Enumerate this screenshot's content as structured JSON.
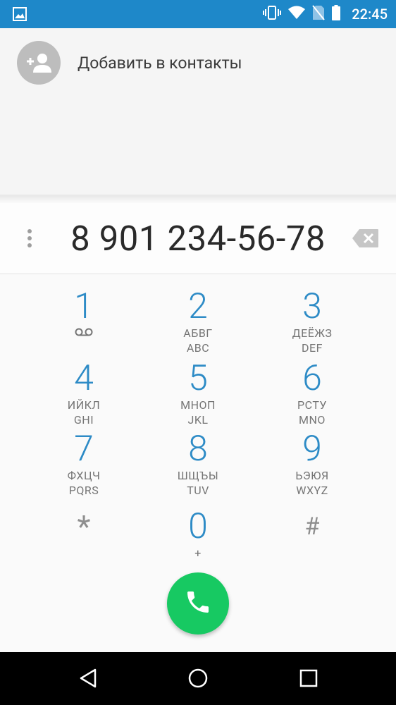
{
  "status_bar": {
    "time": "22:45",
    "icons": [
      "gallery-icon",
      "vibrate-icon",
      "wifi-icon",
      "no-sim-icon",
      "battery-icon"
    ]
  },
  "contact_area": {
    "add_contact_label": "Добавить в контакты",
    "icon": "add-contact-icon"
  },
  "dial_field": {
    "number": "8 901 234-56-78",
    "overflow_icon": "more-vert-icon",
    "backspace_icon": "backspace-icon"
  },
  "keypad": {
    "keys": [
      {
        "digit": "1",
        "line1": "",
        "line2": ""
      },
      {
        "digit": "2",
        "line1": "АБВГ",
        "line2": "ABC"
      },
      {
        "digit": "3",
        "line1": "ДЕЁЖЗ",
        "line2": "DEF"
      },
      {
        "digit": "4",
        "line1": "ИЙКЛ",
        "line2": "GHI"
      },
      {
        "digit": "5",
        "line1": "МНОП",
        "line2": "JKL"
      },
      {
        "digit": "6",
        "line1": "РСТУ",
        "line2": "MNO"
      },
      {
        "digit": "7",
        "line1": "ФХЦЧ",
        "line2": "PQRS"
      },
      {
        "digit": "8",
        "line1": "ШЩЪЫ",
        "line2": "TUV"
      },
      {
        "digit": "9",
        "line1": "ЬЭЮЯ",
        "line2": "WXYZ"
      },
      {
        "digit": "*",
        "line1": "",
        "line2": ""
      },
      {
        "digit": "0",
        "line1": "+",
        "line2": ""
      },
      {
        "digit": "#",
        "line1": "",
        "line2": ""
      }
    ]
  },
  "call_button": {
    "icon": "phone-icon",
    "color": "#17c962"
  },
  "nav_bar": {
    "icons": [
      "back-icon",
      "home-icon",
      "recents-icon"
    ]
  },
  "colors": {
    "status_bar": "#1e88c9",
    "digit": "#2d8bc6",
    "call": "#17c962"
  }
}
